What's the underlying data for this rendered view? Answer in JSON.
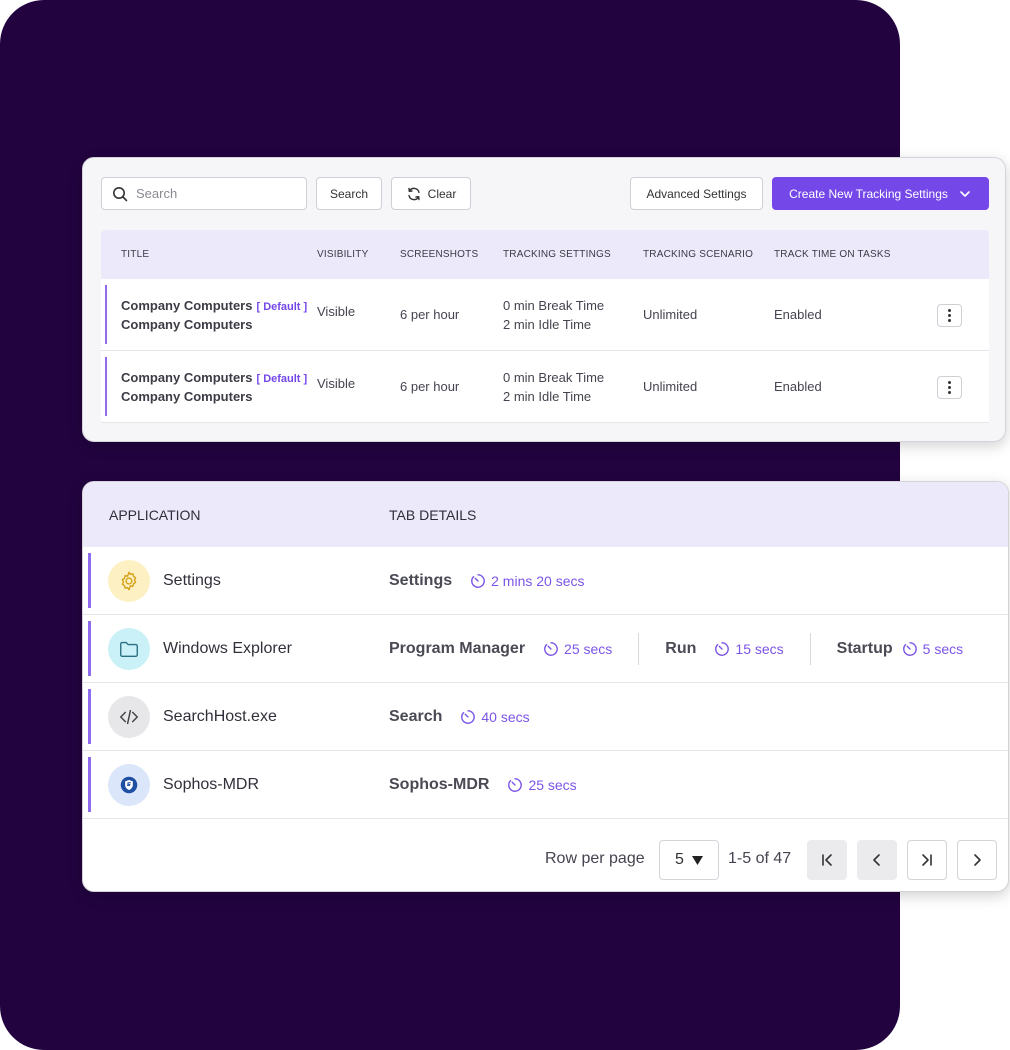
{
  "colors": {
    "background_panel": "#22033f",
    "accent": "#7447e8",
    "header_tint": "#ece9fb",
    "row_indicator": "#8f6bf0"
  },
  "tracking_settings": {
    "search": {
      "placeholder": "Search",
      "value": ""
    },
    "search_button": "Search",
    "clear_button": "Clear",
    "advanced_button": "Advanced Settings",
    "create_button": "Create New Tracking Settings",
    "columns": [
      "TITLE",
      "VISIBILITY",
      "SCREENSHOTS",
      "TRACKING SETTINGS",
      "TRACKING SCENARIO",
      "TRACK TIME ON TASKS"
    ],
    "rows": [
      {
        "title": "Company Computers",
        "badge": "[ Default ]",
        "subtitle": "Company Computers",
        "visibility": "Visible",
        "screenshots": "6 per hour",
        "break_time": "0 min Break Time",
        "idle_time": "2 min Idle Time",
        "scenario": "Unlimited",
        "track_time": "Enabled"
      },
      {
        "title": "Company Computers",
        "badge": "[ Default ]",
        "subtitle": "Company Computers",
        "visibility": "Visible",
        "screenshots": "6 per hour",
        "break_time": "0 min Break Time",
        "idle_time": "2 min Idle Time",
        "scenario": "Unlimited",
        "track_time": "Enabled"
      }
    ]
  },
  "applications": {
    "columns": {
      "application": "APPLICATION",
      "tab_details": "TAB DETAILS"
    },
    "rows": [
      {
        "name": "Settings",
        "icon": "gear-icon",
        "tabs": [
          {
            "name": "Settings",
            "duration": "2 mins 20 secs"
          }
        ]
      },
      {
        "name": "Windows Explorer",
        "icon": "folder-icon",
        "tabs": [
          {
            "name": "Program Manager",
            "duration": "25 secs"
          },
          {
            "name": "Run",
            "duration": "15 secs"
          },
          {
            "name": "Startup",
            "duration": "5 secs"
          }
        ]
      },
      {
        "name": "SearchHost.exe",
        "icon": "code-icon",
        "tabs": [
          {
            "name": "Search",
            "duration": "40 secs"
          }
        ]
      },
      {
        "name": "Sophos-MDR",
        "icon": "sophos-shield-icon",
        "tabs": [
          {
            "name": "Sophos-MDR",
            "duration": "25 secs"
          }
        ]
      }
    ],
    "pagination": {
      "rows_per_page_label": "Row per page",
      "rows_per_page": "5",
      "range": "1-5 of 47"
    }
  }
}
